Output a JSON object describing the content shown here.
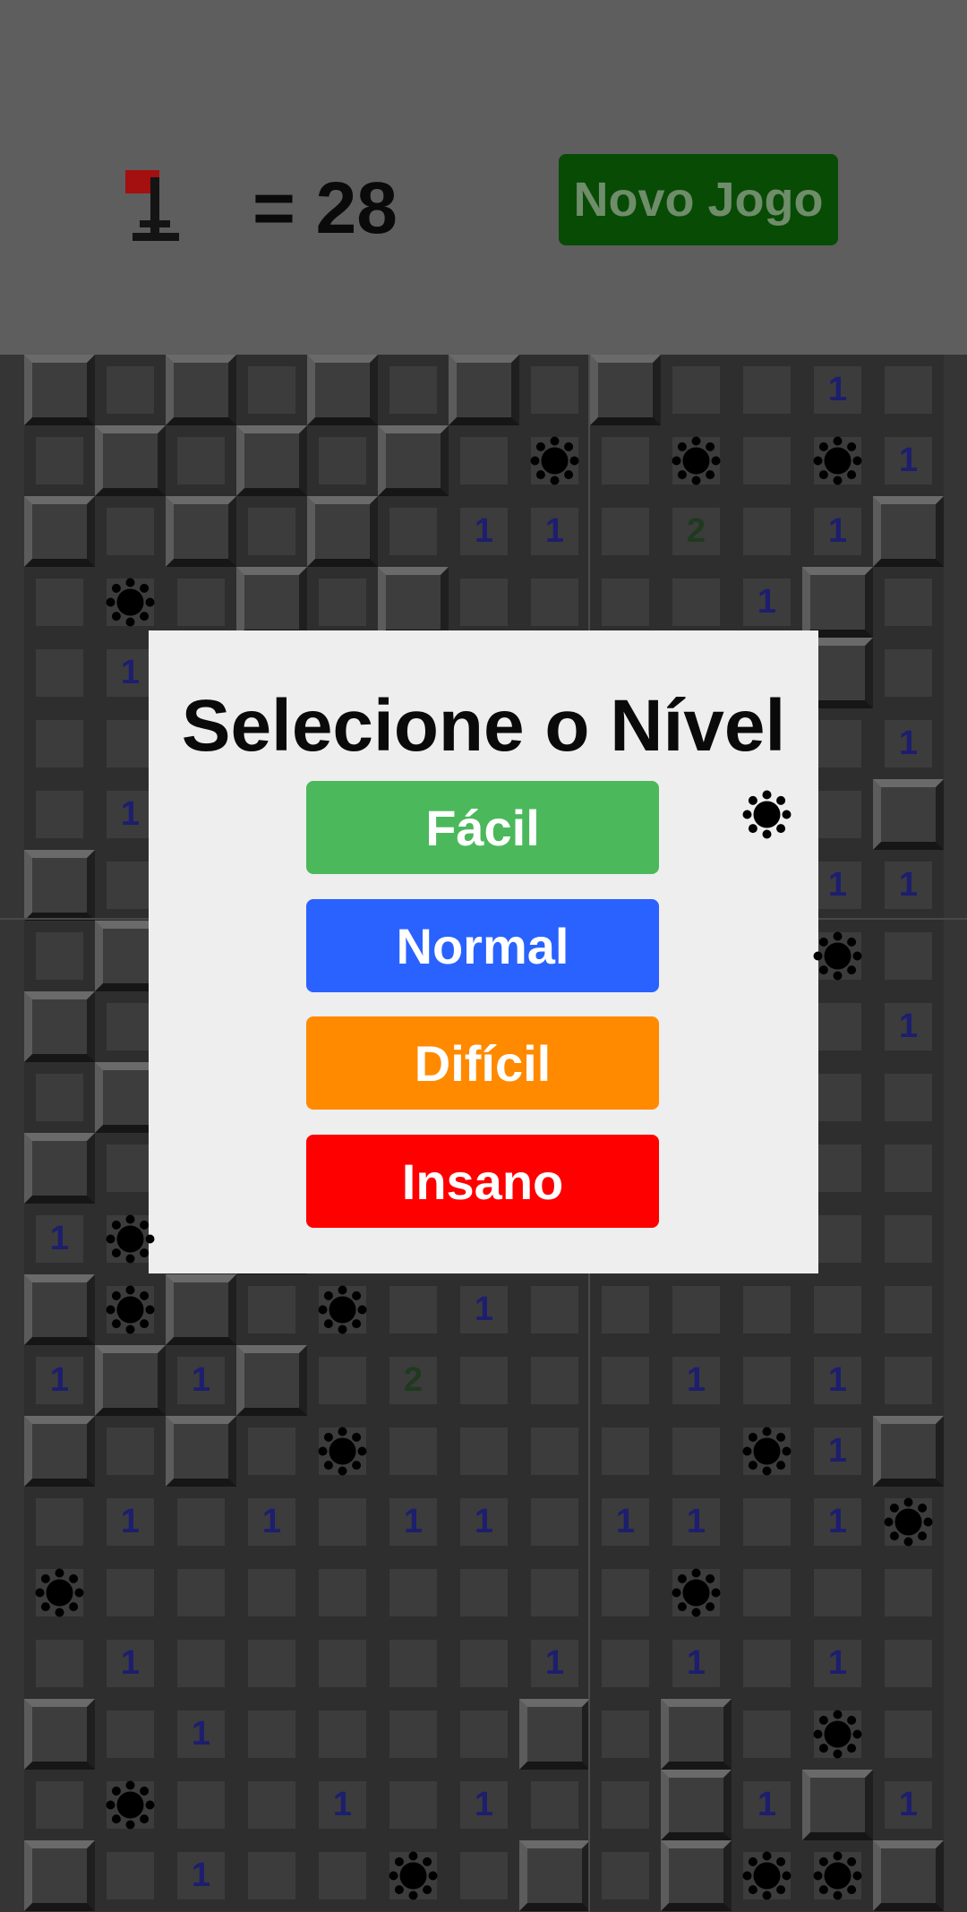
{
  "header": {
    "flag_icon": "flag-icon",
    "flags_label": "= 28",
    "new_game_label": "Novo Jogo",
    "new_game_color": "#074b05"
  },
  "board": {
    "cols": 13,
    "rows": 22,
    "rows_data": [
      "RoRoRoRoR.o1rMR.RoR",
      "oRoRoRoM MoM1.R.o",
      "RoRoRo11 2 1RoR",
      "oMoRoRoo.o1RoR",
      "o1oRoRoRoRoRoR",
      "oooooooooooo11",
      "o1ooooooooMoRR",
      "RoRoooooooo11",
      "oRoooooooooMo",
      "RoRooooooooo1o",
      "oRooooooooooo",
      "RoRooooooooooo",
      "1MoRoooooooooo",
      "RMRoMo1oooooo",
      "1R1Ro2ooo1o1o",
      "RoRoMoooooM1R",
      "o1o1o11o11o1M",
      "Mooooooo Mooo1o",
      "o1ooooo1o1o1oR",
      "Ro1ooooRoRoMo",
      "oMoo1o1ooR1R1R",
      "Ro1ooMoRoRMMR"
    ]
  },
  "modal": {
    "title": "Selecione o Nível",
    "levels": [
      {
        "label": "Fácil",
        "color": "#4cb85c"
      },
      {
        "label": "Normal",
        "color": "#2962ff"
      },
      {
        "label": "Difícil",
        "color": "#ff8a00"
      },
      {
        "label": "Insano",
        "color": "#ff0000"
      }
    ]
  }
}
